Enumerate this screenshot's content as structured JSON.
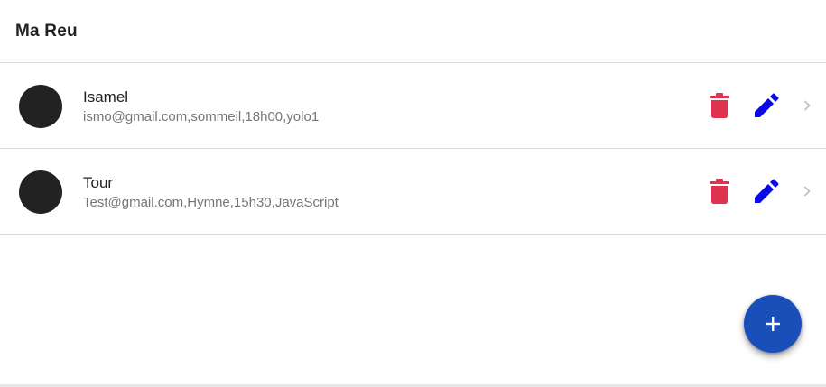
{
  "toolbar": {
    "title": "Ma Reu"
  },
  "meetings": [
    {
      "name": "Isamel",
      "details": "ismo@gmail.com,sommeil,18h00,yolo1",
      "avatar_color": "#222222"
    },
    {
      "name": "Tour",
      "details": "Test@gmail.com,Hymne,15h30,JavaScript",
      "avatar_color": "#222222"
    }
  ],
  "icons": {
    "delete": "trash-icon",
    "edit": "pencil-icon",
    "chevron": "chevron-right-icon",
    "add": "plus-icon"
  },
  "colors": {
    "delete": "#e0334f",
    "edit": "#0a0ae6",
    "fab": "#1a4fba",
    "chevron": "#bdbdbd"
  }
}
